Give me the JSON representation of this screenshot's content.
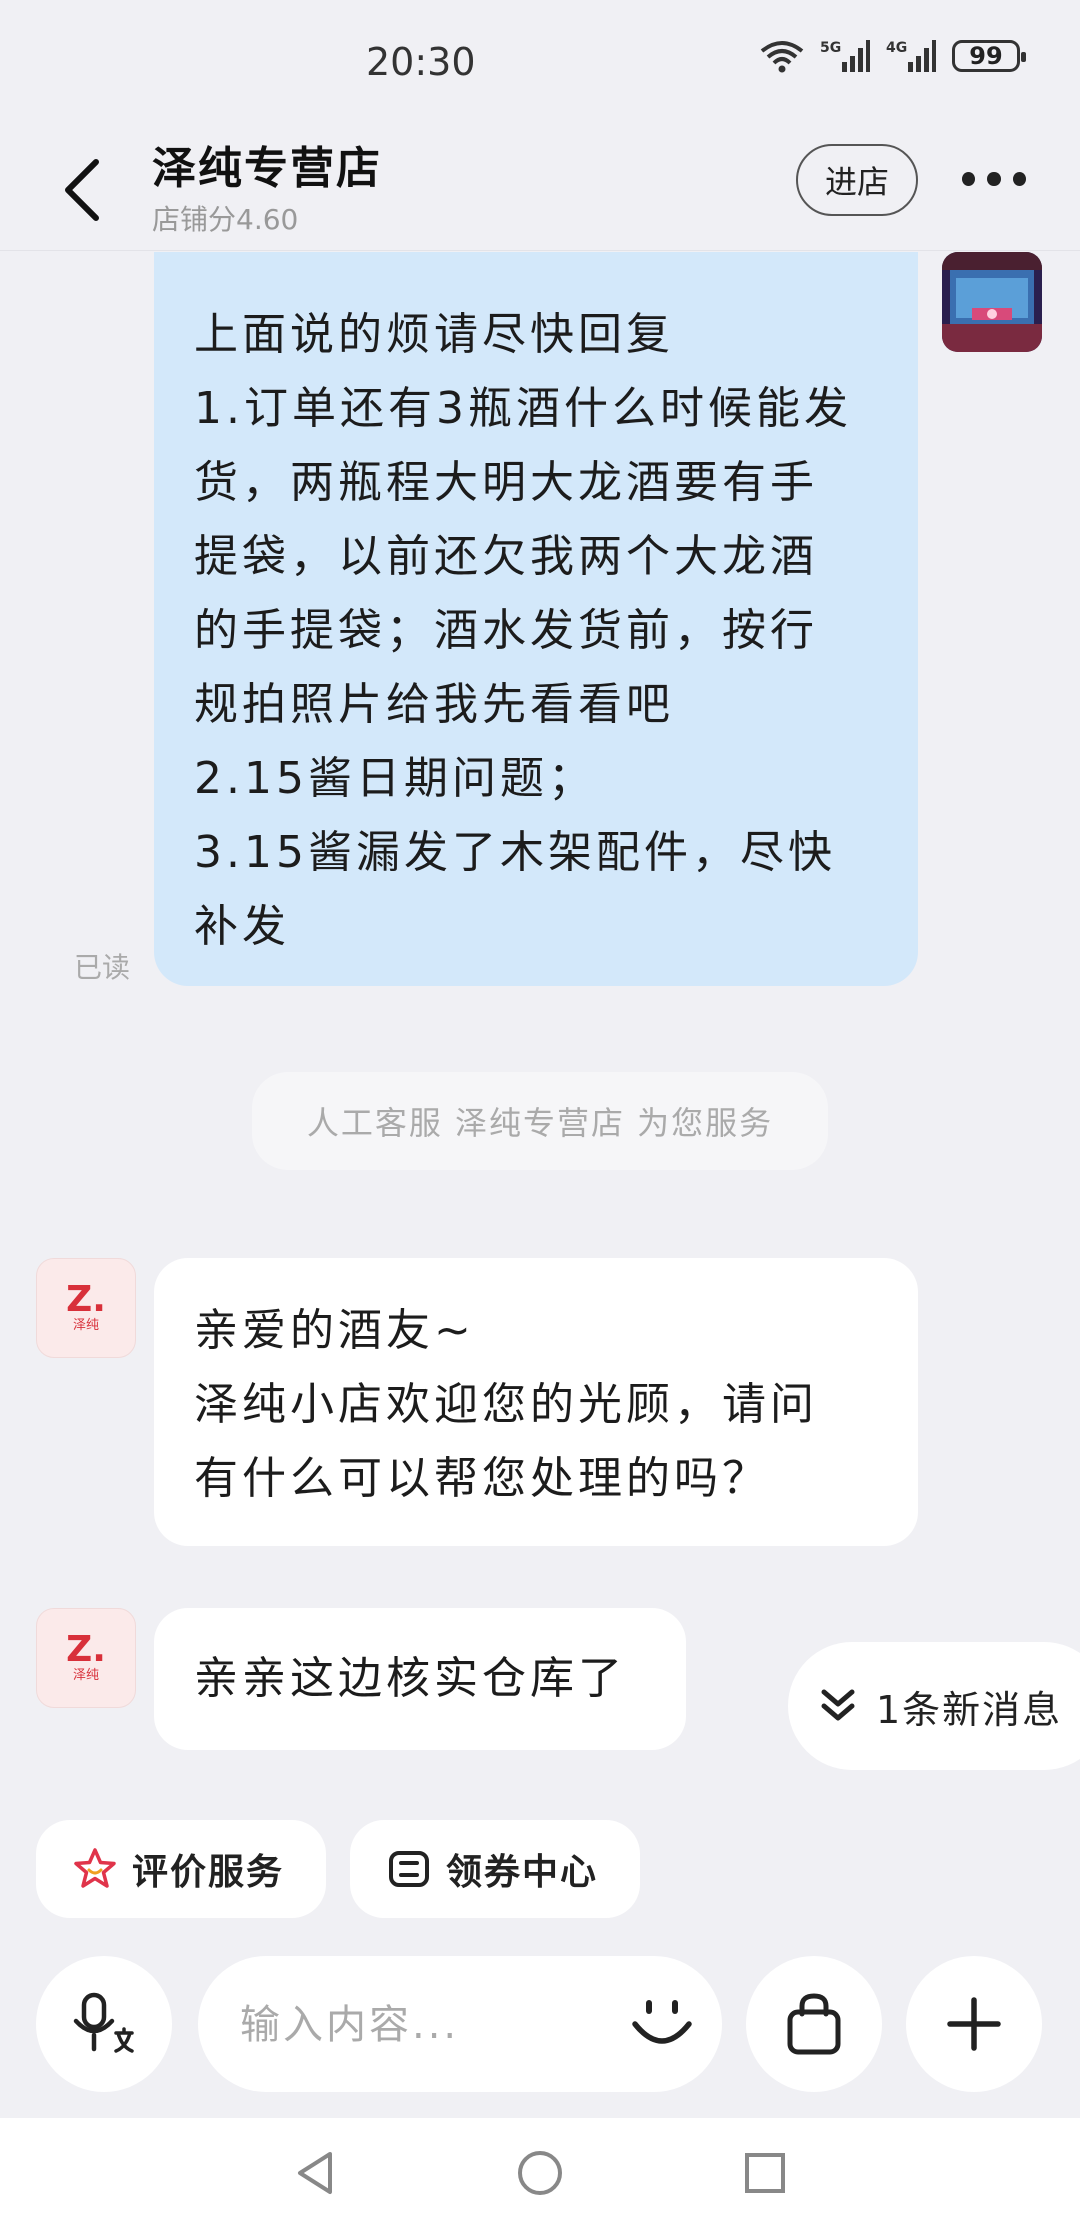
{
  "status_bar": {
    "time": "20:30",
    "network_1": "5G",
    "network_2": "4G",
    "battery": "99"
  },
  "header": {
    "title": "泽纯专营店",
    "score": "店铺分4.60",
    "enter_label": "进店"
  },
  "messages": {
    "mine": {
      "lines": [
        "上面说的烦请尽快回复",
        "1.订单还有3瓶酒什么时候能发",
        "货，两瓶程大明大龙酒要有手",
        "提袋，以前还欠我两个大龙酒",
        "的手提袋；酒水发货前，按行",
        "规拍照片给我先看看吧",
        "2.15酱日期问题；",
        "3.15酱漏发了木架配件，尽快",
        "补发"
      ],
      "read_status": "已读"
    },
    "system_notice": "人工客服 泽纯专营店 为您服务",
    "shop_1": {
      "lines": [
        "亲爱的酒友~",
        "泽纯小店欢迎您的光顾，请问",
        "有什么可以帮您处理的吗？"
      ]
    },
    "shop_2": {
      "lines": [
        "亲亲这边核实仓库了"
      ]
    },
    "shop_logo": {
      "mark": "Z.",
      "sub": "泽纯"
    }
  },
  "new_message_pill": "1条新消息",
  "quick_actions": {
    "rate_label": "评价服务",
    "coupon_label": "领券中心"
  },
  "input": {
    "placeholder": "输入内容..."
  },
  "colors": {
    "my_bubble": "#d3e8fa",
    "background": "#f0f0f4",
    "shop_logo_red": "#d8303a"
  }
}
